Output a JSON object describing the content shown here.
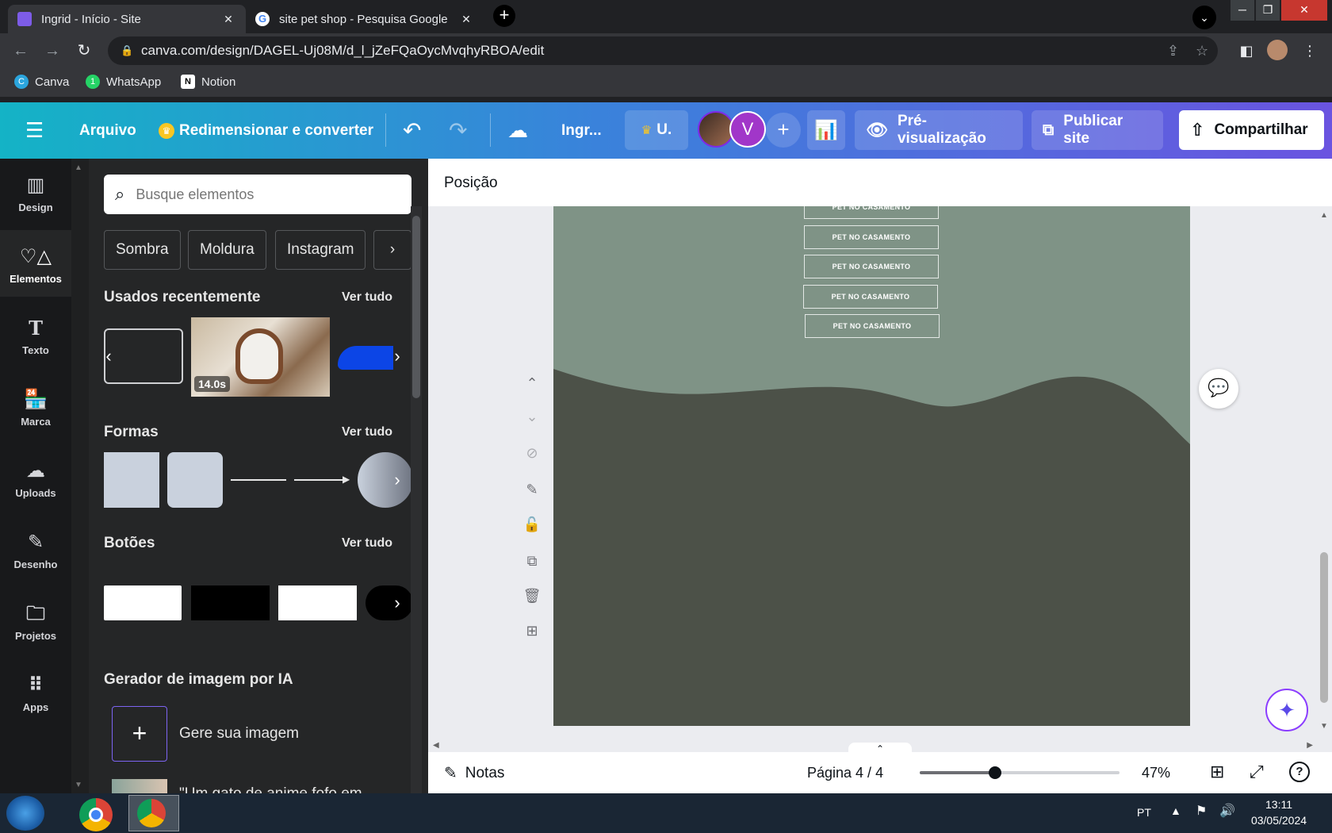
{
  "browser": {
    "tabs": [
      {
        "title": "Ingrid - Início - Site",
        "active": true
      },
      {
        "title": "site pet shop - Pesquisa Google",
        "active": false
      }
    ],
    "url": "canva.com/design/DAGEL-Uj08M/d_l_jZeFQaOycMvqhyRBOA/edit",
    "bookmarks": [
      "Canva",
      "WhatsApp",
      "Notion"
    ],
    "whatsapp_badge": "1"
  },
  "header": {
    "file": "Arquivo",
    "resize": "Redimensionar e converter",
    "doc_title": "Ingr...",
    "upgrade": "U.",
    "avatar_letter": "V",
    "preview": "Pré-visualização",
    "publish": "Publicar site",
    "share": "Compartilhar"
  },
  "rail": [
    {
      "label": "Design",
      "icon": "layout-icon"
    },
    {
      "label": "Elementos",
      "icon": "shapes-icon"
    },
    {
      "label": "Texto",
      "icon": "text-icon"
    },
    {
      "label": "Marca",
      "icon": "brand-icon"
    },
    {
      "label": "Uploads",
      "icon": "upload-icon"
    },
    {
      "label": "Desenho",
      "icon": "draw-icon"
    },
    {
      "label": "Projetos",
      "icon": "folder-icon"
    },
    {
      "label": "Apps",
      "icon": "apps-icon"
    }
  ],
  "panel": {
    "search_placeholder": "Busque elementos",
    "chips": [
      "Sombra",
      "Moldura",
      "Instagram"
    ],
    "recent_title": "Usados recentemente",
    "see_all": "Ver tudo",
    "video_duration": "14.0s",
    "shapes_title": "Formas",
    "buttons_title": "Botões",
    "ai_title": "Gerador de imagem por IA",
    "ai_generate": "Gere sua imagem",
    "ai_prompt_partial": "\"Um gato de anime fofo em"
  },
  "canvas": {
    "toolbar_label": "Posição",
    "buttons": [
      "PET NO CASAMENTO",
      "PET NO CASAMENTO",
      "PET NO CASAMENTO",
      "PET NO CASAMENTO",
      "PET NO CASAMENTO"
    ],
    "colors": {
      "page_top": "#7f9386",
      "page_bottom": "#4c5148"
    }
  },
  "bottom": {
    "notes": "Notas",
    "page": "Página 4 / 4",
    "zoom": "47%",
    "zoom_level": 0.47
  },
  "taskbar": {
    "lang": "PT",
    "time": "13:11",
    "date": "03/05/2024"
  }
}
